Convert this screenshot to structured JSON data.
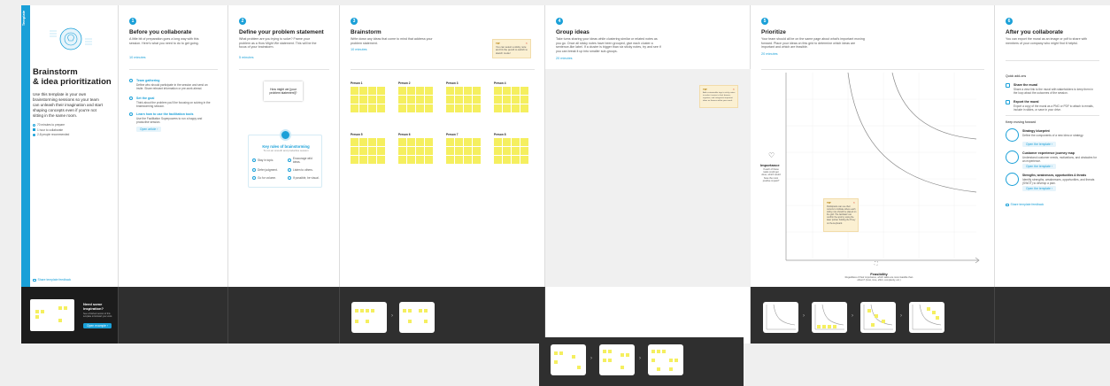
{
  "colors": {
    "accent": "#1aa0d8",
    "sticky": "#f5ef5f",
    "note": "#fbf0d2",
    "dark": "#2f2f2f"
  },
  "intro": {
    "tag": "Template",
    "title_line1": "Brainstorm",
    "title_line2": "& idea prioritization",
    "desc": "Use this template in your own brainstorming sessions so your team can unleash their imagination and start shaping concepts even if you're not sitting in the same room.",
    "meta": [
      "70 minutes to prepare",
      "1 hour to collaborate",
      "2-8 people recommended"
    ],
    "feedback": "Share template feedback",
    "banner_title": "Need some inspiration?",
    "banner_desc": "See a finished version of this template to kickstart your work.",
    "banner_btn": "Open example"
  },
  "steps": [
    {
      "num": "1",
      "title": "Before you collaborate",
      "desc": "A little bit of preparation goes a long way with this session. Here's what you need to do to get going.",
      "time": "10 minutes"
    },
    {
      "num": "2",
      "title": "Define your problem statement",
      "desc": "What problem are you trying to solve? Frame your problem as a How Might We statement. This will be the focus of your brainstorm.",
      "time": "5 minutes"
    },
    {
      "num": "3",
      "title": "Brainstorm",
      "desc": "Write down any ideas that come to mind that address your problem statement.",
      "time": "10 minutes"
    },
    {
      "num": "4",
      "title": "Group ideas",
      "desc": "Take turns sharing your ideas while clustering similar or related notes as you go. Once all sticky notes have been grouped, give each cluster a sentence-like label. If a cluster is bigger than six sticky notes, try and see if you can break it up into smaller sub-groups.",
      "time": "20 minutes"
    },
    {
      "num": "5",
      "title": "Prioritize",
      "desc": "Your team should all be on the same page about what's important moving forward. Place your ideas on this grid to determine which ideas are important and which are feasible.",
      "time": "20 minutes"
    },
    {
      "num": "6",
      "title": "After you collaborate",
      "desc": "You can export the mural as an image or pdf to share with members of your company who might find it helpful."
    }
  ],
  "prep": [
    {
      "title": "Team gathering",
      "desc": "Define who should participate in the session and send an invite. Share relevant information or pre-work ahead."
    },
    {
      "title": "Set the goal",
      "desc": "Think about the problem you'll be focusing on solving in the brainstorming session."
    },
    {
      "title": "Learn how to use the facilitation tools",
      "desc": "Use the Facilitation Superpowers to run a happy and productive session."
    }
  ],
  "prep_btn": "Open article",
  "problem_card": "How might we [your problem statement]?",
  "rules": {
    "title": "Key rules of brainstorming",
    "subtitle": "To run an smooth and productive session",
    "items": [
      "Stay in topic.",
      "Encourage wild ideas.",
      "Defer judgment.",
      "Listen to others.",
      "Go for volume.",
      "If possible, be visual."
    ]
  },
  "tip_brainstorm": "You can select a sticky note and hit the pencil to switch to sketch mode!",
  "persons": [
    "Person 1",
    "Person 2",
    "Person 3",
    "Person 4",
    "Person 5",
    "Person 6",
    "Person 7",
    "Person 8"
  ],
  "tip_group": "Add customizable tags to sticky notes to make it easier to find, browse, organize, and categorize important ideas as themes within your mural.",
  "prioritize": {
    "y_label": "Importance",
    "y_desc": "If each of these tasks could get done, which would have the most positive impact?",
    "x_label": "Feasibility",
    "x_desc": "Regardless of their importance, which tasks are more feasible than others? (Cost, time, effort, complexity, etc.)",
    "tip": "Participants can use their cursors to indicate where each sticky note should be placed on the grid. The facilitator can confirm the spot by using the laser pointer holding the H key on the keyboard."
  },
  "after": {
    "quick_title": "Quick add-ons",
    "quick": [
      {
        "title": "Share the mural",
        "desc": "Share a view link to the mural with stakeholders to keep them in the loop about the outcomes of the session."
      },
      {
        "title": "Export the mural",
        "desc": "Export a copy of the mural as a PNG or PDF to attach to emails, include in slides, or save in your drive."
      }
    ],
    "next_title": "Keep moving forward",
    "next": [
      {
        "title": "Strategy blueprint",
        "desc": "Define the components of a new idea or strategy.",
        "btn": "Open the template"
      },
      {
        "title": "Customer experience journey map",
        "desc": "Understand customer needs, motivations, and obstacles for an experience.",
        "btn": "Open the template"
      },
      {
        "title": "Strengths, weaknesses, opportunities & threats",
        "desc": "Identify strengths, weaknesses, opportunities, and threats (SWOT) to develop a plan.",
        "btn": "Open the template"
      }
    ],
    "feedback": "Share template feedback"
  }
}
